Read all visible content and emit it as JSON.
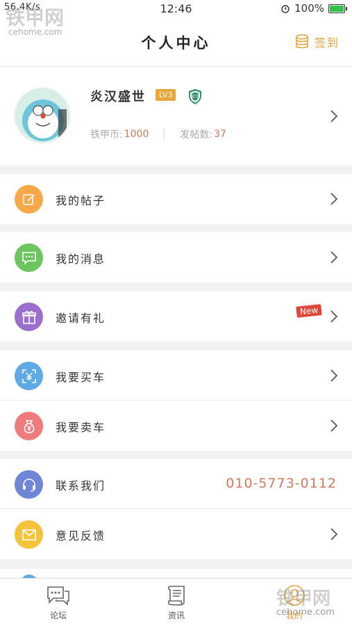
{
  "status_bar": {
    "carrier": "56.4K/s",
    "time": "12:46",
    "battery": "100%",
    "battery_level": 1.0
  },
  "watermark": {
    "text": "铁甲网",
    "url": "cehome.com"
  },
  "header": {
    "title": "个人中心",
    "checkin_label": "签到"
  },
  "profile": {
    "username": "炎汉盛世",
    "level": "LV3",
    "badge": "实习",
    "coins_label": "铁甲币:",
    "coins_value": "1000",
    "posts_label": "发帖数:",
    "posts_value": "37"
  },
  "menu": {
    "my_posts": "我的帖子",
    "my_messages": "我的消息",
    "invite": "邀请有礼",
    "invite_badge": "New",
    "buy_car": "我要买车",
    "sell_car": "我要卖车",
    "contact": "联系我们",
    "contact_phone": "010-5773-0112",
    "feedback": "意见反馈"
  },
  "tabbar": {
    "forum": "论坛",
    "news": "资讯",
    "mine": "我的"
  },
  "colors": {
    "accent": "#e6a23c",
    "orange": "#f7a94a",
    "green": "#6cc55e",
    "purple": "#9b6fce",
    "blue": "#5fa9e6",
    "red": "#ef7c7c",
    "indigo": "#6f86d6",
    "yellow": "#f5c33b",
    "value": "#d4785a"
  }
}
